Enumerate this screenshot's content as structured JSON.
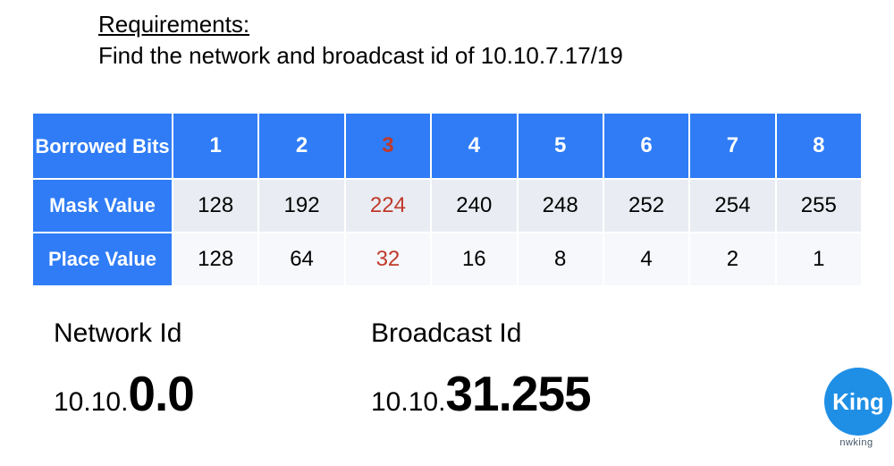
{
  "requirements": {
    "title": "Requirements:",
    "text": "Find the network and broadcast id of 10.10.7.17/19"
  },
  "table": {
    "highlight_index": 2,
    "header": {
      "label": "Borrowed Bits",
      "cols": [
        "1",
        "2",
        "3",
        "4",
        "5",
        "6",
        "7",
        "8"
      ]
    },
    "rows": [
      {
        "label": "Mask Value",
        "values": [
          "128",
          "192",
          "224",
          "240",
          "248",
          "252",
          "254",
          "255"
        ]
      },
      {
        "label": "Place Value",
        "values": [
          "128",
          "64",
          "32",
          "16",
          "8",
          "4",
          "2",
          "1"
        ]
      }
    ]
  },
  "results": {
    "network": {
      "label": "Network Id",
      "prefix": "10.10.",
      "big": "0.0"
    },
    "broadcast": {
      "label": "Broadcast Id",
      "prefix": "10.10.",
      "big": "31.255"
    }
  },
  "logo": {
    "circle": "King",
    "sub": "nwking"
  },
  "chart_data": {
    "type": "table",
    "title": "CIDR borrowed-bits reference",
    "columns": [
      "Borrowed Bits",
      "1",
      "2",
      "3",
      "4",
      "5",
      "6",
      "7",
      "8"
    ],
    "rows": [
      [
        "Mask Value",
        128,
        192,
        224,
        240,
        248,
        252,
        254,
        255
      ],
      [
        "Place Value",
        128,
        64,
        32,
        16,
        8,
        4,
        2,
        1
      ]
    ],
    "highlight_column": 3
  }
}
